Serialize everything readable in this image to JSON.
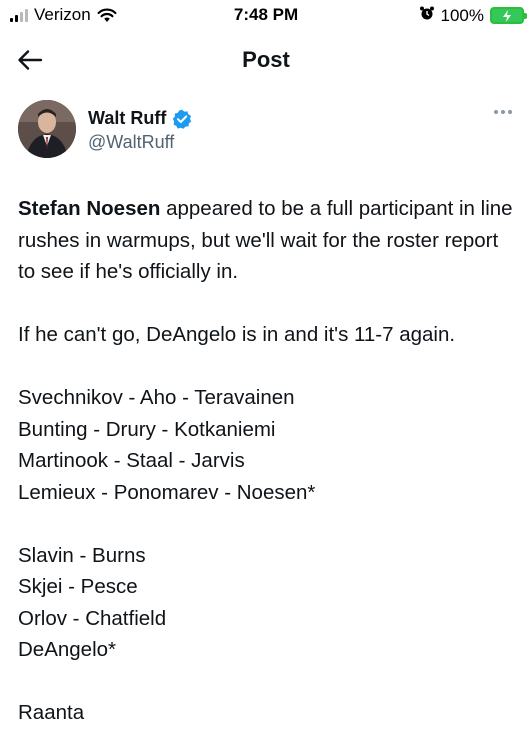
{
  "status_bar": {
    "carrier": "Verizon",
    "time": "7:48 PM",
    "battery": "100%",
    "icons": [
      "signal-icon",
      "wifi-icon",
      "alarm-icon",
      "battery-charging-icon"
    ]
  },
  "header": {
    "title": "Post",
    "back_icon": "back-arrow-icon"
  },
  "author": {
    "name": "Walt Ruff",
    "handle": "@WaltRuff",
    "verified": true,
    "verified_color": "#1d9bf0"
  },
  "tweet": {
    "lead_bold": "Stefan Noesen",
    "lead_rest": " appeared to be a full participant in line rushes in warmups, but we'll wait for the roster report to see if he's officially in.",
    "line2": "If he can't go, DeAngelo is in and it's 11-7 again.",
    "forwards": [
      "Svechnikov - Aho - Teravainen",
      "Bunting - Drury - Kotkaniemi",
      "Martinook - Staal - Jarvis",
      "Lemieux - Ponomarev - Noesen*"
    ],
    "defense": [
      "Slavin - Burns",
      "Skjei - Pesce",
      "Orlov - Chatfield",
      "DeAngelo*"
    ],
    "goalie": "Raanta"
  },
  "colors": {
    "text": "#0f1419",
    "secondary": "#536471",
    "battery": "#34c759"
  }
}
